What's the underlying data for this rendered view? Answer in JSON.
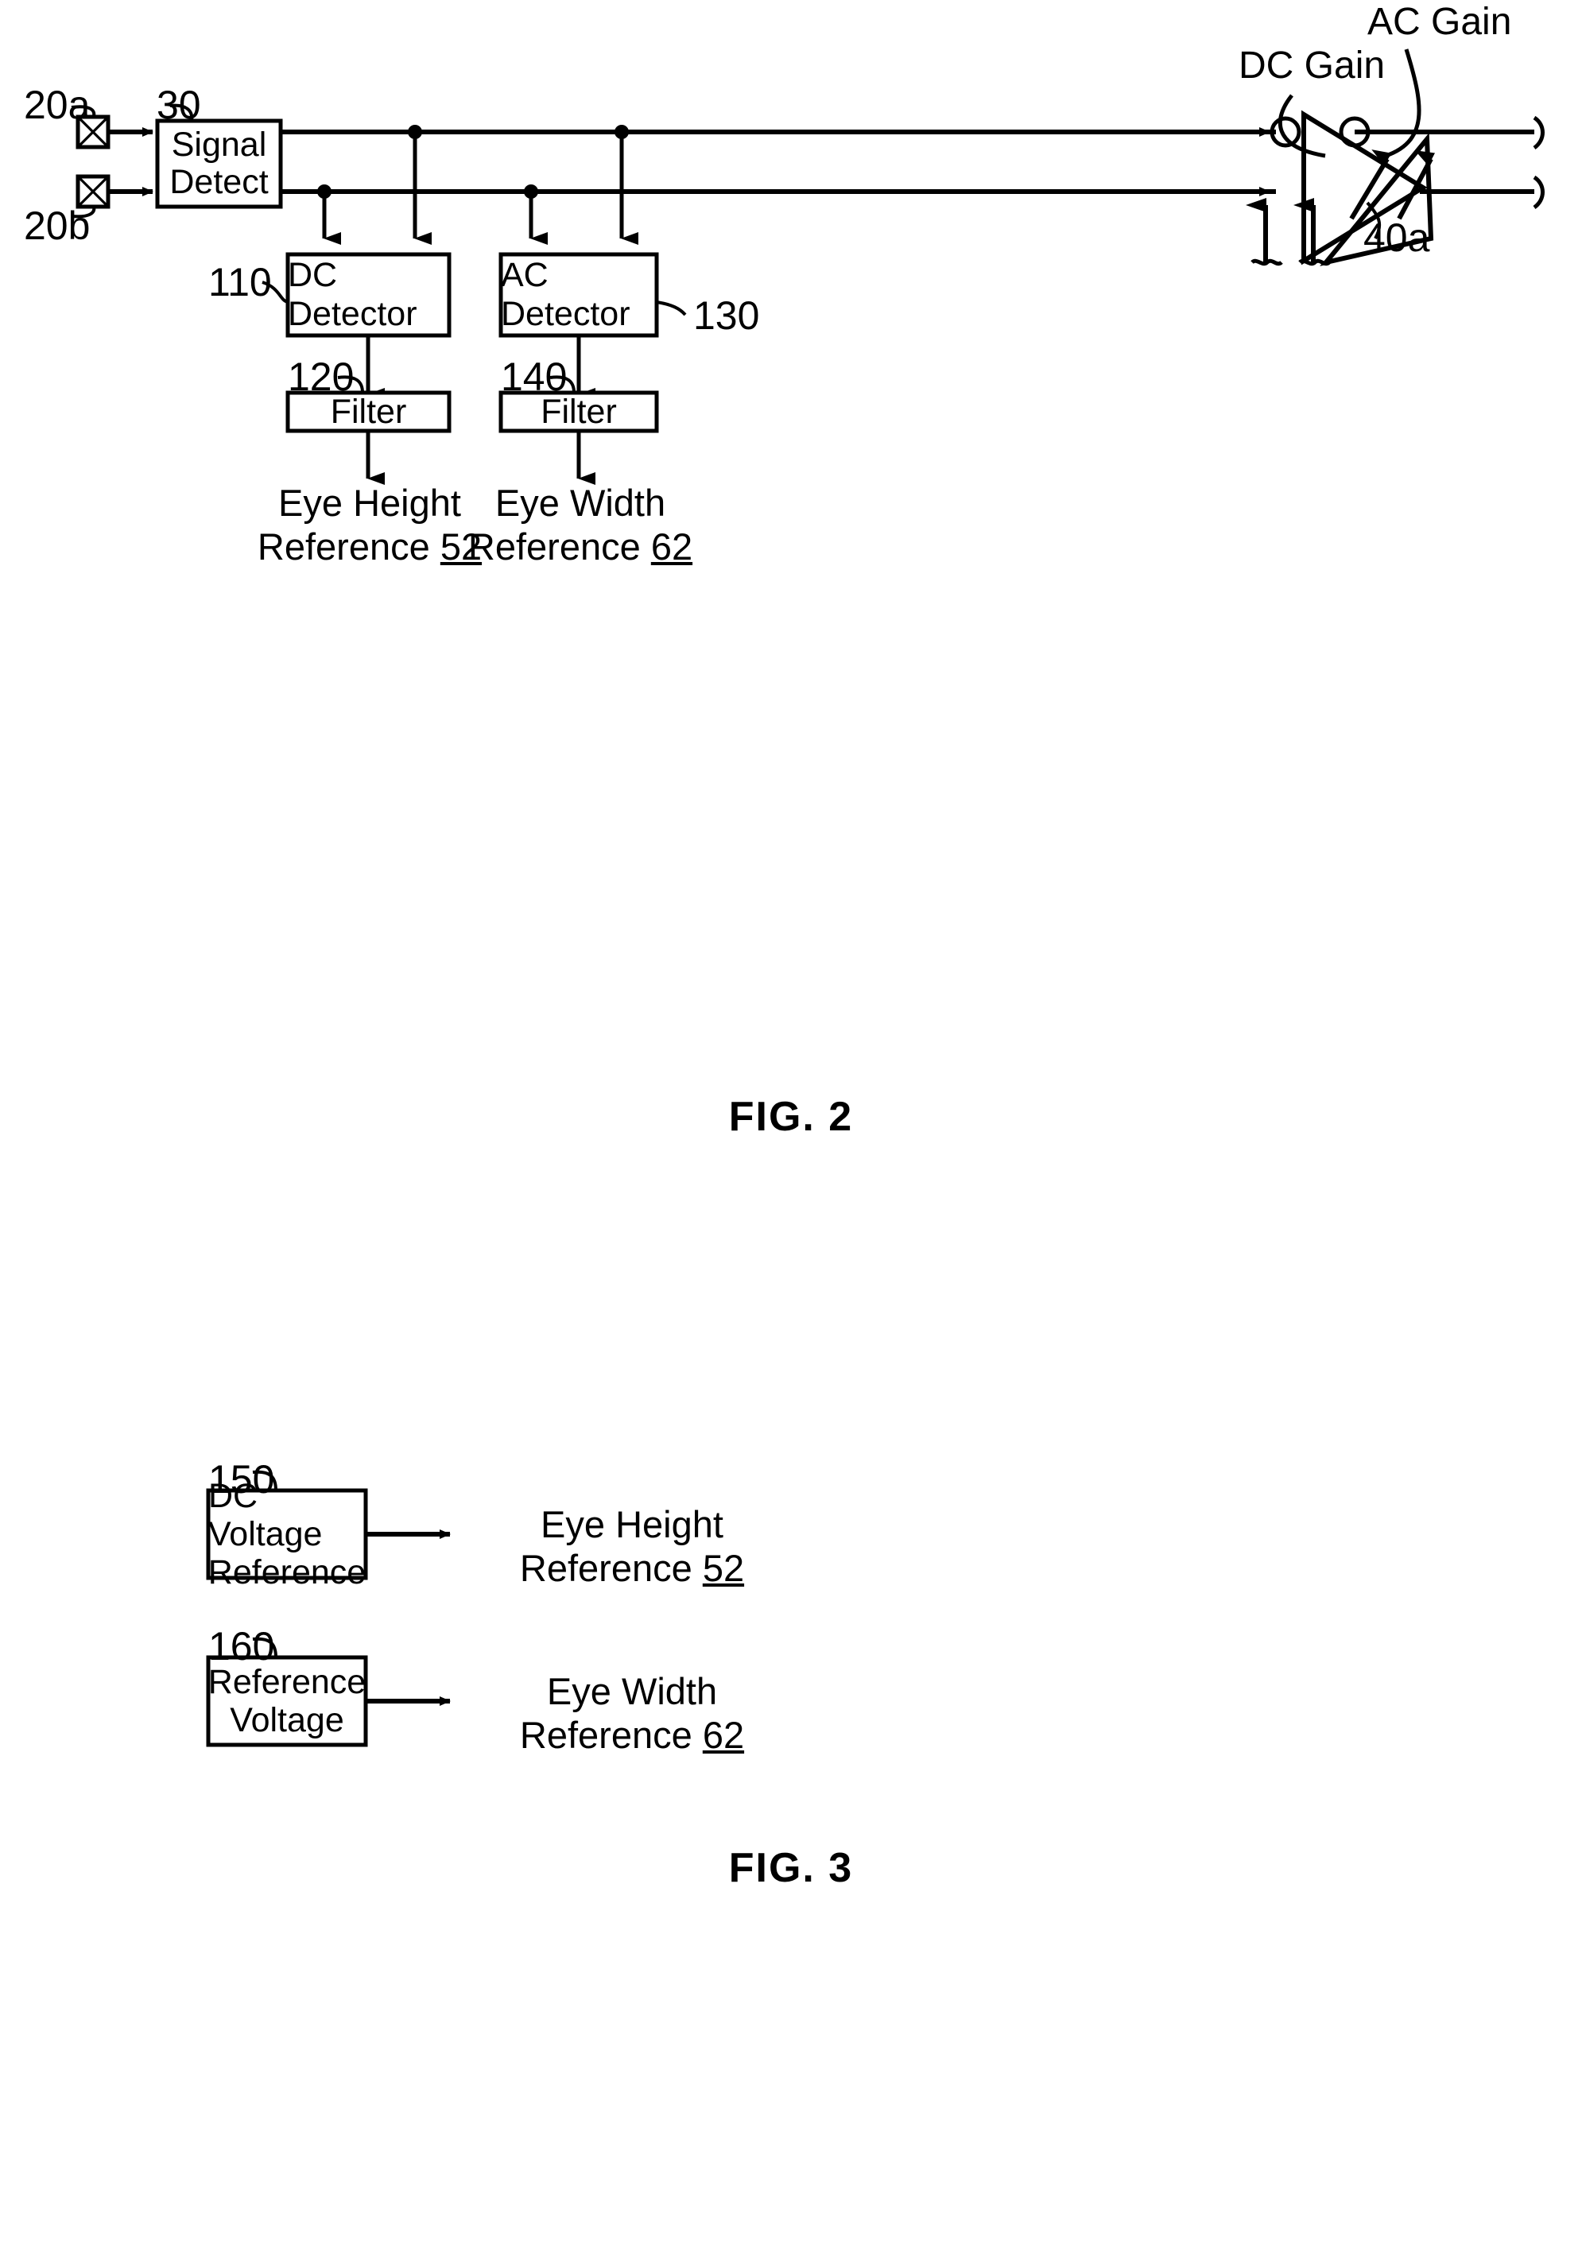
{
  "document": {
    "type": "patent-figure-sheet",
    "background_color": "#ffffff",
    "ink_color": "#000000"
  },
  "figures": [
    {
      "id": "fig2",
      "caption": "FIG. 2",
      "inputs": [
        {
          "label": "20a",
          "icon": "crossed-box-terminal"
        },
        {
          "label": "20b",
          "icon": "crossed-box-terminal"
        }
      ],
      "blocks": [
        {
          "ref": "30",
          "label_line1": "Signal",
          "label_line2": "Detect"
        },
        {
          "ref": "110",
          "label_line1": "DC Detector",
          "label_line2": ""
        },
        {
          "ref": "130",
          "label_line1": "AC Detector",
          "label_line2": ""
        },
        {
          "ref": "120",
          "label_line1": "Filter",
          "label_line2": ""
        },
        {
          "ref": "140",
          "label_line1": "Filter",
          "label_line2": ""
        }
      ],
      "amplifier": {
        "ref": "40a",
        "control_labels": [
          {
            "name": "DC Gain"
          },
          {
            "name": "AC Gain"
          }
        ]
      },
      "outputs": [
        {
          "line1": "Eye Height",
          "line2": "Reference",
          "ref": "52"
        },
        {
          "line1": "Eye Width",
          "line2": "Reference",
          "ref": "62"
        }
      ]
    },
    {
      "id": "fig3",
      "caption": "FIG. 3",
      "rows": [
        {
          "ref": "150",
          "block_line1": "DC Voltage",
          "block_line2": "Reference",
          "out_line1": "Eye Height",
          "out_line2": "Reference",
          "out_ref": "52"
        },
        {
          "ref": "160",
          "block_line1": "Reference",
          "block_line2": "Voltage",
          "out_line1": "Eye Width",
          "out_line2": "Reference",
          "out_ref": "62"
        }
      ]
    }
  ]
}
